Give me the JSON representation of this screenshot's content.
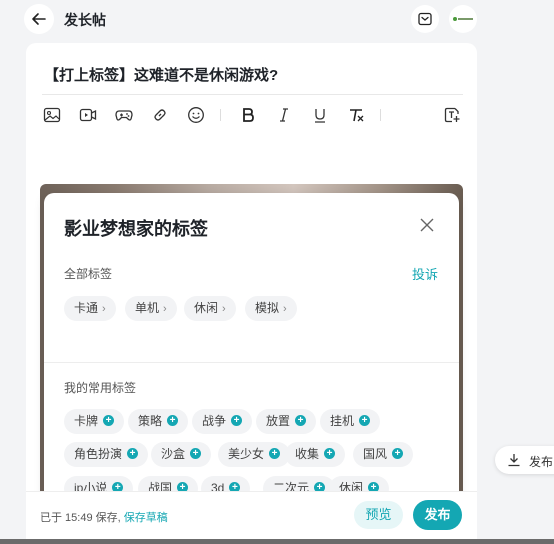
{
  "header": {
    "title": "发长帖",
    "back_icon": "arrow-left-icon",
    "drafts_icon": "inbox-icon"
  },
  "editor": {
    "title": "【打上标签】这难道不是休闲游戏?",
    "toolbar": [
      "image-icon",
      "video-icon",
      "game-icon",
      "link-icon",
      "emoji-icon",
      "bold-icon",
      "italic-icon",
      "underline-icon",
      "clear-format-icon",
      "insert-block-icon"
    ]
  },
  "modal": {
    "title": "影业梦想家的标签",
    "all_tags_label": "全部标签",
    "report_label": "投诉",
    "all_tags": [
      "卡通",
      "单机",
      "休闲",
      "模拟"
    ],
    "common_tags_label": "我的常用标签",
    "common_tags": [
      [
        "卡牌",
        "策略",
        "战争",
        "放置",
        "挂机"
      ],
      [
        "角色扮演",
        "沙盒",
        "美少女",
        "收集",
        "国风"
      ],
      [
        "ip小说",
        "战国",
        "3d",
        "二次元",
        "休闲"
      ]
    ]
  },
  "footer": {
    "save_status": "已于 15:49 保存,",
    "save_draft_label": "保存草稿",
    "preview_label": "预览",
    "publish_label": "发布"
  },
  "float_publish_label": "发布",
  "colors": {
    "accent": "#14a7b3",
    "background": "#f3f4f6"
  }
}
